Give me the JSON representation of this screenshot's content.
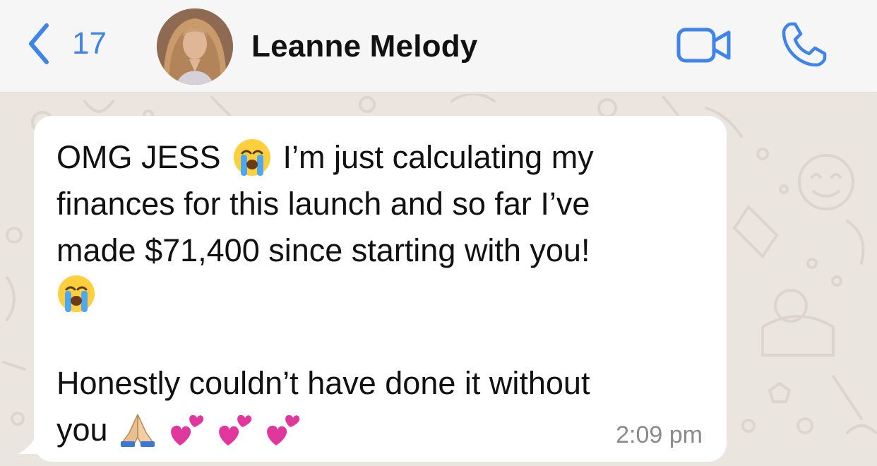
{
  "header": {
    "back_count": "17",
    "contact_name": "Leanne Melody"
  },
  "message": {
    "line1_a": "OMG JESS",
    "line1_b": "I’m just calculating my",
    "line2": "finances for this launch and so far I’ve",
    "line3": "made $71,400 since starting with you!",
    "line5": "Honestly couldn’t have done it without",
    "line6": "you",
    "time": "2:09 pm"
  },
  "icons": {
    "back": "chevron-left-icon",
    "video": "video-camera-icon",
    "call": "phone-icon",
    "emoji_crying": "loudly-crying-face-emoji",
    "emoji_pray": "folded-hands-emoji",
    "emoji_hearts": "two-hearts-emoji"
  },
  "colors": {
    "accent": "#3e84ea",
    "header_bg": "#f6f6f6",
    "chat_bg": "#ebe5df",
    "bubble_bg": "#ffffff",
    "timestamp": "#8a8a8a"
  }
}
